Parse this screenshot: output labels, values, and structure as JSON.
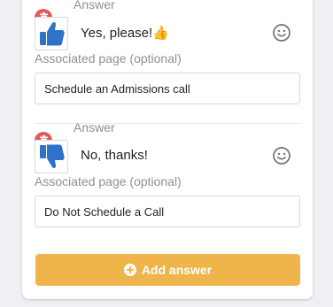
{
  "answers": [
    {
      "section_label": "Answer",
      "text": "Yes, please!👍",
      "thumb_icon": "thumbs-up",
      "associated_label": "Associated page (optional)",
      "page_value": "Schedule an Admissions call"
    },
    {
      "section_label": "Answer",
      "text": "No, thanks!",
      "thumb_icon": "thumbs-down",
      "associated_label": "Associated page (optional)",
      "page_value": "Do Not Schedule a Call"
    }
  ],
  "add_button": {
    "label": "Add answer",
    "icon": "plus-circle-icon"
  },
  "colors": {
    "accent": "#f0b54a",
    "delete": "#e35a5a",
    "thumb_blue": "#2e73c9",
    "muted_text": "#8b8f96"
  }
}
